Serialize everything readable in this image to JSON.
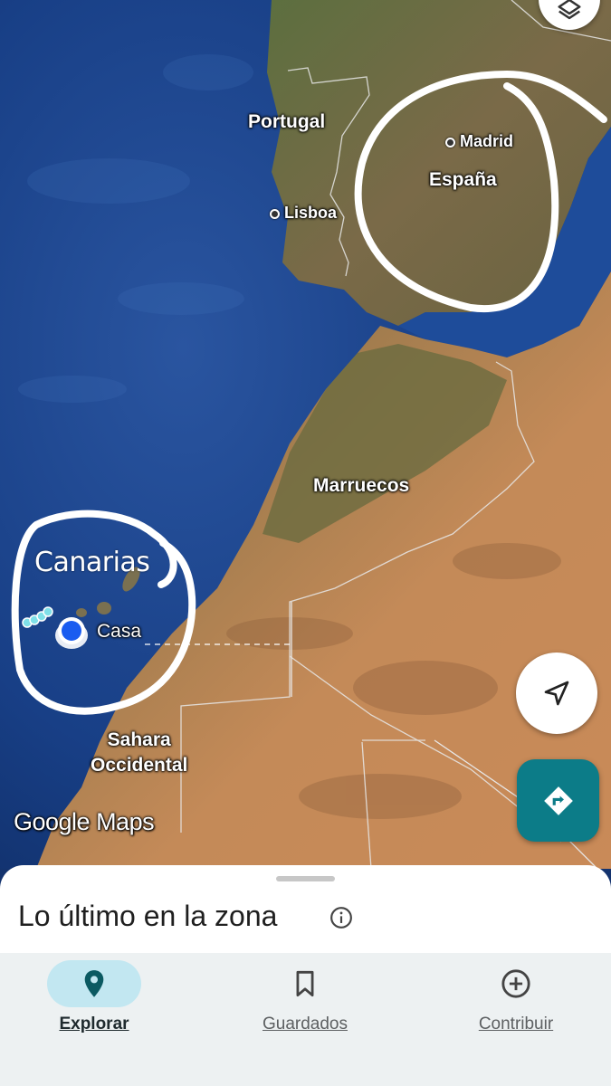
{
  "map": {
    "labels": {
      "portugal": "Portugal",
      "lisboa": "Lisboa",
      "madrid": "Madrid",
      "espana": "España",
      "marruecos": "Marruecos",
      "sahara": "Sahara\nOccidental",
      "casa": "Casa"
    },
    "annotation_text": "Canarias",
    "attribution": "Google Maps",
    "colors": {
      "ocean": "#14336e",
      "land_green": "#556b3a",
      "land_desert": "#c48a58",
      "annotation": "#ffffff",
      "location_dot": "#1a5cf0"
    }
  },
  "controls": {
    "layers_icon": "layers-icon",
    "my_location_icon": "navigation-arrow-icon",
    "directions_icon": "directions-icon"
  },
  "sheet": {
    "title": "Lo último en la zona",
    "info_icon": "info-icon"
  },
  "nav": {
    "items": [
      {
        "label": "Explorar",
        "icon": "location-pin-icon",
        "active": true
      },
      {
        "label": "Guardados",
        "icon": "bookmark-icon",
        "active": false
      },
      {
        "label": "Contribuir",
        "icon": "add-circle-icon",
        "active": false
      }
    ],
    "accent": "#c2e7f1"
  }
}
